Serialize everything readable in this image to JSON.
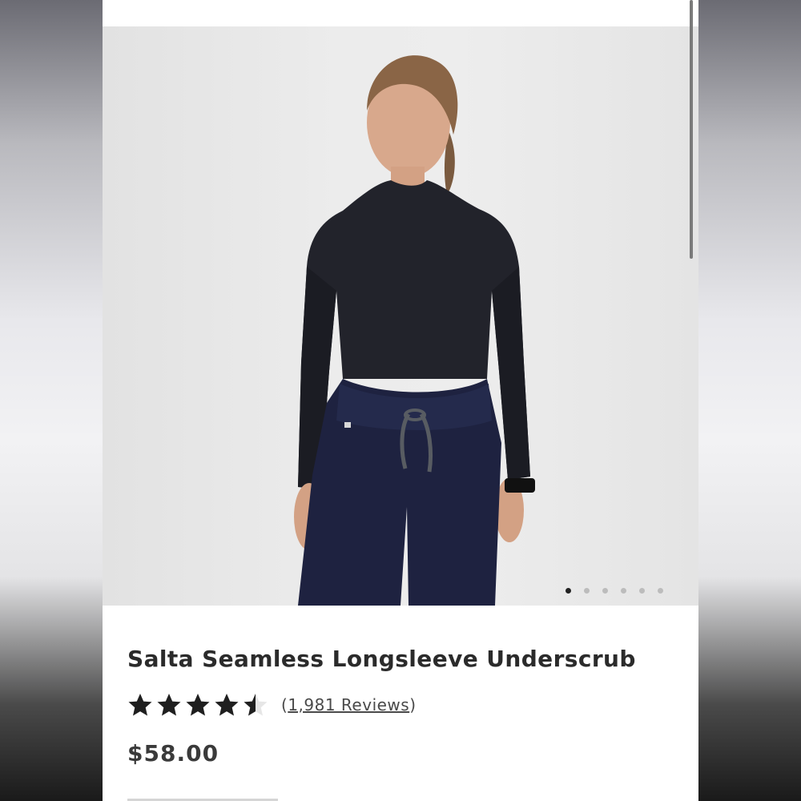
{
  "product": {
    "title": "Salta Seamless Longsleeve Underscrub",
    "rating_value": 4.5,
    "rating_max": 5,
    "reviews_open": "(",
    "reviews_link": "1,981 Reviews",
    "reviews_close": ")",
    "price": "$58.00"
  },
  "gallery": {
    "image_count": 6,
    "active_index": 0
  },
  "colors": {
    "star": "#1f1f1f",
    "dot_active": "#222222",
    "dot_inactive": "#bcbcbc",
    "title": "#2b2b2b"
  }
}
